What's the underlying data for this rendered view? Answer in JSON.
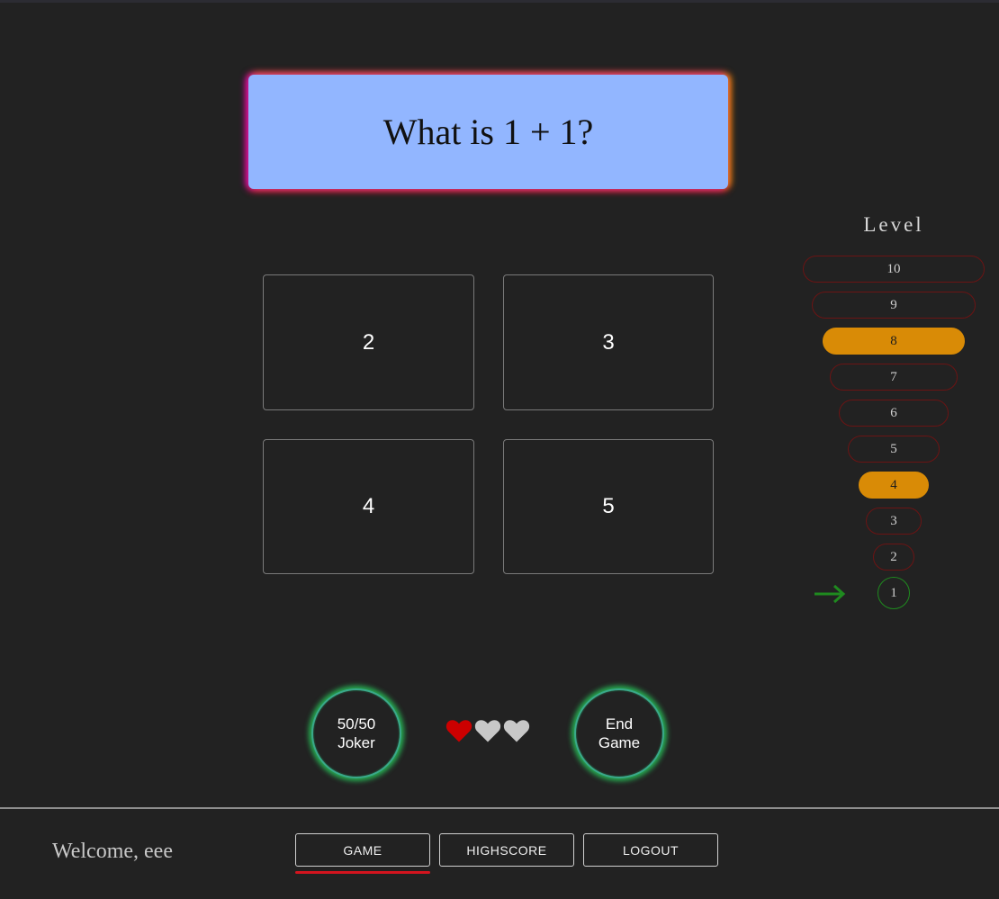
{
  "question": {
    "text": "What is 1 + 1?"
  },
  "answers": [
    "2",
    "3",
    "4",
    "5"
  ],
  "level": {
    "title": "Level",
    "steps": [
      {
        "label": "10",
        "state": "normal"
      },
      {
        "label": "9",
        "state": "normal"
      },
      {
        "label": "8",
        "state": "milestone"
      },
      {
        "label": "7",
        "state": "normal"
      },
      {
        "label": "6",
        "state": "normal"
      },
      {
        "label": "5",
        "state": "normal"
      },
      {
        "label": "4",
        "state": "milestone"
      },
      {
        "label": "3",
        "state": "normal"
      },
      {
        "label": "2",
        "state": "normal"
      },
      {
        "label": "1",
        "state": "current"
      }
    ],
    "current_indicator": "right-arrow-icon"
  },
  "controls": {
    "joker_line1": "50/50",
    "joker_line2": "Joker",
    "end_line1": "End",
    "end_line2": "Game"
  },
  "lives": {
    "total": 3,
    "remaining": 1,
    "filled_color": "#cc0000",
    "empty_color": "#c8c8c8"
  },
  "footer": {
    "welcome": "Welcome, eee",
    "nav": {
      "game": "GAME",
      "highscore": "HIGHSCORE",
      "logout": "LOGOUT"
    },
    "active": "GAME"
  },
  "colors": {
    "milestone": "#d98b06",
    "question_bg": "#92b6ff",
    "current_level": "#1f8a1f",
    "accent_underline": "#d4141e"
  }
}
